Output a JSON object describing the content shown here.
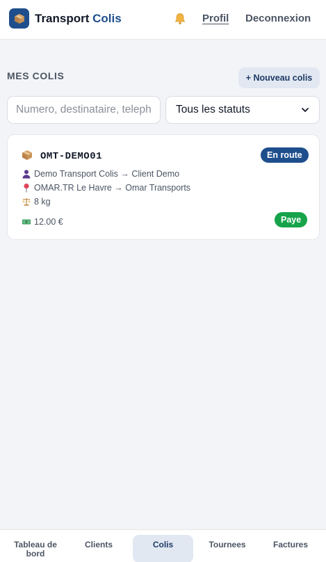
{
  "header": {
    "brand_main": "Transport",
    "brand_accent": "Colis",
    "profile_label": "Profil",
    "logout_label": "Deconnexion"
  },
  "section": {
    "title": "MES COLIS",
    "new_button": "+ Nouveau colis"
  },
  "filters": {
    "search_value": "",
    "search_placeholder": "Numero, destinataire, telephone",
    "status_selected": "Tous les statuts"
  },
  "parcels": [
    {
      "tracking": "OMT-DEMO01",
      "status": "En route",
      "route": "Demo Transport Colis → Client Demo",
      "places": "OMAR.TR Le Havre → Omar Transports",
      "weight": "8 kg",
      "price": "12.00 €",
      "payment": "Paye"
    }
  ],
  "bottom_nav": {
    "tabs": [
      "Tableau de bord",
      "Clients",
      "Colis",
      "Tournees",
      "Factures"
    ],
    "active": "Colis"
  },
  "colors": {
    "brand": "#1e4e8c",
    "status_en_route": "#1e4e8c",
    "status_paid": "#16a34a",
    "background": "#f3f4f7"
  },
  "icons": {
    "logo": "package-icon",
    "notifications": "bell-icon",
    "route": "person-icon",
    "places": "pin-icon",
    "weight": "scale-icon",
    "price": "banknote-icon"
  }
}
